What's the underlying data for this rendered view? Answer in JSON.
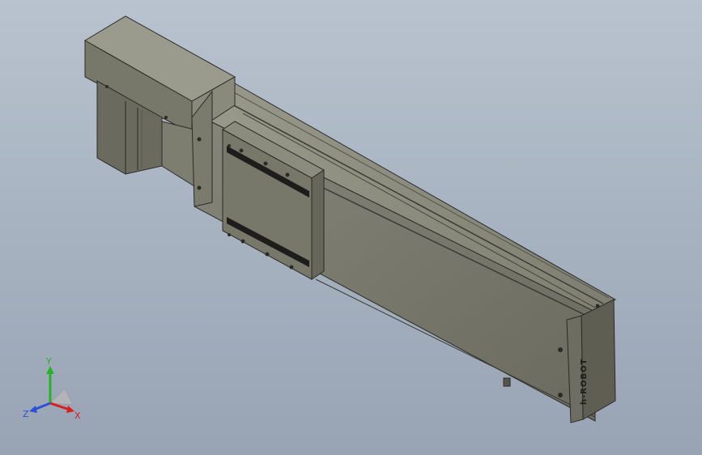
{
  "viewport": {
    "background_top": "#b9c3cf",
    "background_bottom": "#98a4b4"
  },
  "model": {
    "body_color": "#6f6f62",
    "body_dark": "#4a4a41",
    "body_light": "#8a8a7c",
    "edge_color": "#2b2b27",
    "endcap_logo": "h-ROBOT"
  },
  "triad": {
    "x_label": "X",
    "y_label": "Y",
    "z_label": "Z",
    "x_color": "#d81e1e",
    "y_color": "#27b327",
    "z_color": "#2e4fd8"
  }
}
